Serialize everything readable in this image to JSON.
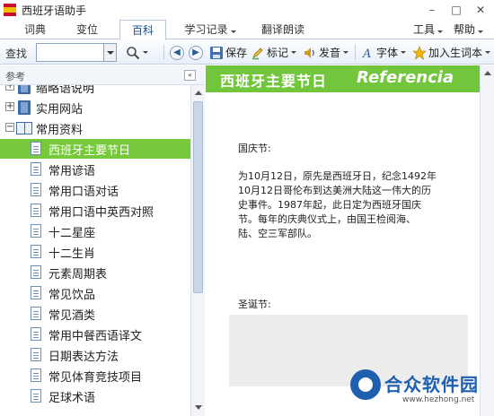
{
  "window": {
    "title": "西班牙语助手",
    "minimize": "–",
    "maximize": "□",
    "close": "✕"
  },
  "tabs": [
    {
      "label": "词典"
    },
    {
      "label": "变位"
    },
    {
      "label": "百科"
    },
    {
      "label": "学习记录",
      "has_dropdown": true
    },
    {
      "label": "翻译朗读"
    }
  ],
  "menu": {
    "tools": "工具",
    "help": "帮助"
  },
  "toolbar": {
    "search_label": "查找",
    "search_value": "",
    "save": "保存",
    "mark": "标记",
    "pronounce": "发音",
    "font": "字体",
    "add_vocab": "加入生词本"
  },
  "sidebar": {
    "title": "参考",
    "collapse": "«",
    "items": [
      {
        "label": "缩略语说明",
        "type": "book",
        "expander": "+"
      },
      {
        "label": "实用网站",
        "type": "book",
        "expander": "+"
      },
      {
        "label": "常用资料",
        "type": "open-book",
        "expander": "−"
      },
      {
        "label": "西班牙主要节日",
        "type": "doc",
        "selected": true
      },
      {
        "label": "常用谚语",
        "type": "doc"
      },
      {
        "label": "常用口语对话",
        "type": "doc"
      },
      {
        "label": "常用口语中英西对照",
        "type": "doc"
      },
      {
        "label": "十二星座",
        "type": "doc"
      },
      {
        "label": "十二生肖",
        "type": "doc"
      },
      {
        "label": "元素周期表",
        "type": "doc"
      },
      {
        "label": "常见饮品",
        "type": "doc"
      },
      {
        "label": "常见酒类",
        "type": "doc"
      },
      {
        "label": "常用中餐西语译文",
        "type": "doc"
      },
      {
        "label": "日期表达方法",
        "type": "doc"
      },
      {
        "label": "常见体育竞技项目",
        "type": "doc"
      },
      {
        "label": "足球术语",
        "type": "doc"
      }
    ]
  },
  "content": {
    "title": "西班牙主要节日",
    "subtitle": "Referencia",
    "sections": [
      {
        "heading": "国庆节:",
        "lines": [
          "为10月12日，原先是西班牙日，纪念1492年",
          "10月12日哥伦布到达美洲大陆这一伟大的历",
          "史事件。1987年起，此日定为西班牙国庆",
          "节。每年的庆典仪式上，由国王检阅海、",
          "陆、空三军部队。"
        ]
      },
      {
        "heading": "圣诞节:",
        "lines": []
      }
    ]
  },
  "watermark": {
    "name": "合众软件园",
    "url": "www.hezhong.net"
  },
  "colors": {
    "accent_green": "#72c63b",
    "tab_text": "#1f4e8c",
    "watermark_blue": "#1f5fb0"
  }
}
